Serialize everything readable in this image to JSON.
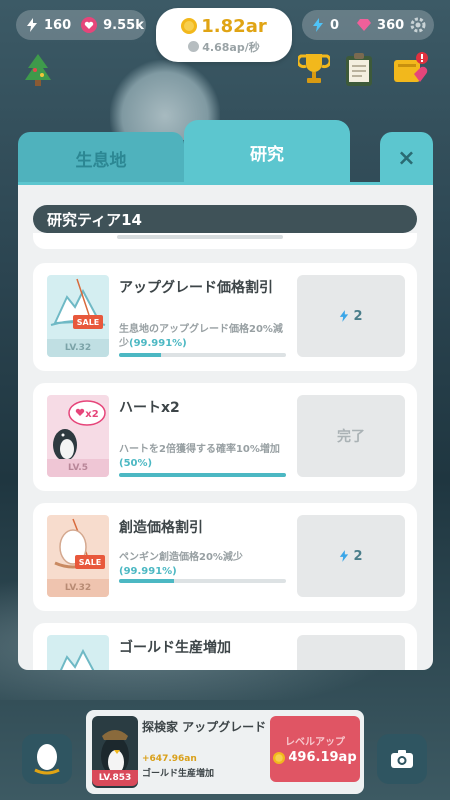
{
  "top": {
    "bolt_count": "160",
    "heart_count": "9.55k",
    "gold_amount": "1.82ar",
    "gold_rate": "4.68ap/秒",
    "energy_count": "0",
    "gem_count": "360"
  },
  "tabs": {
    "habitat": "生息地",
    "research": "研究",
    "close": "×"
  },
  "tier": "研究ティア14",
  "cards": [
    {
      "title": "アップグレード価格割引",
      "desc": "生息地のアップグレード価格20%減少",
      "pct": "(99.991%)",
      "level": "LV.32",
      "badge": "SALE",
      "progress": 0.25,
      "cost": "2"
    },
    {
      "title": "ハートx2",
      "desc": "ハートを2倍獲得する確率10%増加",
      "pct": "(50%)",
      "level": "LV.5",
      "badge": "x2",
      "progress": 1.0,
      "done": "完了"
    },
    {
      "title": "創造価格割引",
      "desc": "ペンギン創造価格20%減少",
      "pct": "(99.991%)",
      "level": "LV.32",
      "badge": "SALE",
      "progress": 0.33,
      "cost": "2"
    },
    {
      "title": "ゴールド生産増加"
    }
  ],
  "explorer": {
    "title": "探検家 アップグレード",
    "level": "LV.853",
    "gain": "+647.96an",
    "desc": "ゴールド生産増加",
    "lvlup_label": "レベルアップ",
    "lvlup_cost": "496.19ap"
  },
  "colors": {
    "accent": "#5cc6cf",
    "gold": "#e0a414",
    "levelup": "#e05564"
  }
}
